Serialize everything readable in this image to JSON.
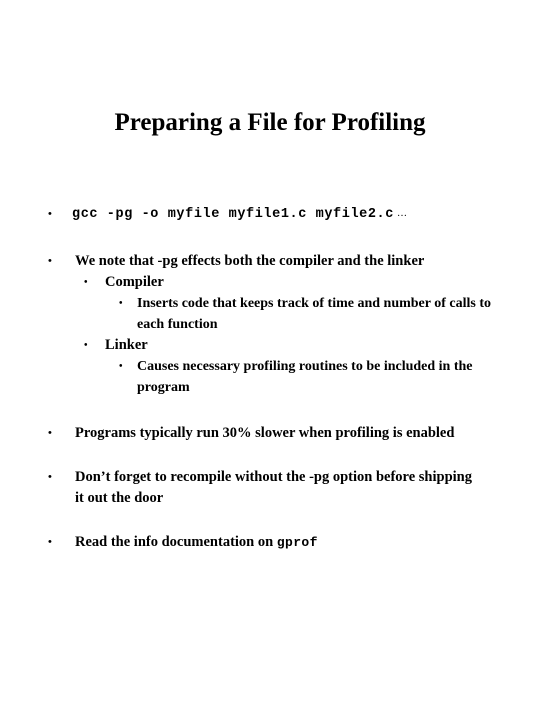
{
  "slide": {
    "title": "Preparing a File for Profiling",
    "background_color": "#ffffff",
    "text_color": "#000000",
    "bullet_glyph": "•",
    "content": [
      {
        "level": 1,
        "style": "code",
        "text": "gcc -pg -o myfile myfile1.c myfile2.c",
        "trailing": "…"
      },
      {
        "level": 1,
        "style": "text",
        "text": "We note that -pg effects both the compiler and the linker"
      },
      {
        "level": 2,
        "style": "text",
        "text": "Compiler"
      },
      {
        "level": 3,
        "style": "text",
        "text": "Inserts code that keeps track of time and number of calls to each function"
      },
      {
        "level": 2,
        "style": "text",
        "text": "Linker"
      },
      {
        "level": 3,
        "style": "text",
        "text": "Causes necessary profiling routines to be included in the program"
      },
      {
        "level": 1,
        "style": "text",
        "text": "Programs typically run 30% slower when profiling is enabled"
      },
      {
        "level": 1,
        "style": "text",
        "text": "Don’t forget to recompile without the -pg option before shipping it out the door"
      },
      {
        "level": 1,
        "style": "mixed",
        "text_prefix": "Read the info documentation on ",
        "text_mono": "gprof"
      }
    ]
  }
}
